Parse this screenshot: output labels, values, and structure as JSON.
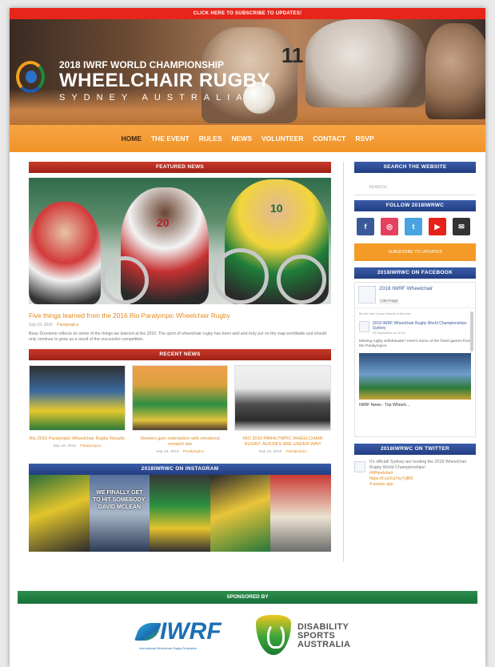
{
  "topbar": {
    "text": "CLICK HERE TO SUBSCRIBE TO UPDATES!"
  },
  "hero": {
    "line1": "2018 IWRF WORLD CHAMPIONSHIP",
    "line2": "WHEELCHAIR RUGBY",
    "line3": "SYDNEY AUSTRALIA",
    "jersey": "11"
  },
  "nav": {
    "items": [
      "HOME",
      "THE EVENT",
      "RULES",
      "NEWS",
      "VOLUNTEER",
      "CONTACT",
      "RSVP"
    ],
    "active": "HOME"
  },
  "featured": {
    "heading": "FEATURED NEWS",
    "numbers": [
      "20",
      "10"
    ],
    "title": "Five things learned from the 2016 Rio Paralympic Wheelchair Rugby",
    "date": "Sep 19, 2016",
    "category": "Paralympics",
    "excerpt": "Beau Dunstone reflects on some of the things we learned at the 2016. The sport of wheelchair rugby has been well and truly put on the map worldwide and should only continue to grow as a result of the successful competition."
  },
  "recent": {
    "heading": "RECENT NEWS",
    "items": [
      {
        "title": "Rio 2016 Paralympic Wheelchair Rugby Results",
        "date": "Sep 19, 2016",
        "category": "Paralympics"
      },
      {
        "title": "Steelers gain redemption with emotional rematch win",
        "date": "Sep 15, 2016",
        "category": "Paralympics"
      },
      {
        "title": "RIO 2016 PARALYMPIC WHEELCHAIR RUGBY: AUSSIES ARE UNDER WAY!",
        "date": "Sep 15, 2016",
        "category": "Paralympics"
      }
    ]
  },
  "instagram": {
    "heading": "2018IWRWC ON INSTAGRAM",
    "overlay": "WE FINALLY GET TO HIT SOMEBODY. DAVID MCLEAN"
  },
  "sidebar": {
    "search_heading": "SEARCH THE WEBSITE",
    "search_placeholder": "SEARCH",
    "follow_heading": "FOLLOW 2018IWRWC",
    "social_glyphs": {
      "facebook": "f",
      "instagram": "◎",
      "twitter": "t",
      "youtube": "▶",
      "email": "✉"
    },
    "subscribe_label": "SUBSCRIBE TO UPDATES",
    "facebook_heading": "2018IWRWC ON FACEBOOK",
    "fb_page_name": "2018 IWRF Wheelchair",
    "fb_like": "Like Page",
    "fb_note": "Be the first of your friends to like this",
    "fb_post_name": "2018 IWRF Wheelchair Rugby World Championships Sydney",
    "fb_post_date": "23 September at 16:10",
    "fb_post_text": "Missing rugby withdrawals? Here's some of the finest games from the Paralympics.",
    "fb_video_title": "IWRF News - Top Wheelc...",
    "twitter_heading": "2018IWRWC ON TWITTER",
    "tw_text": "It's official! Sydney are hosting the 2018 Wheelchair Rugby World Championships!",
    "tw_hashtag": "#Wheelchair",
    "tw_link": "https://t.co/Xa7ey7qBN",
    "tw_date": "4 weeks ago"
  },
  "sponsors": {
    "heading": "SPONSORED BY",
    "iwrf_name": "IWRF",
    "iwrf_sub": "International Wheelchair Rugby Federation",
    "das_line1": "DISABILITY",
    "das_line2": "SPORTS",
    "das_line3": "AUSTRALIA"
  },
  "colors": {
    "accent_orange": "#f39a27",
    "red_header": "#b5281c",
    "blue_header": "#2c4a92",
    "green_header": "#1f7f40"
  }
}
